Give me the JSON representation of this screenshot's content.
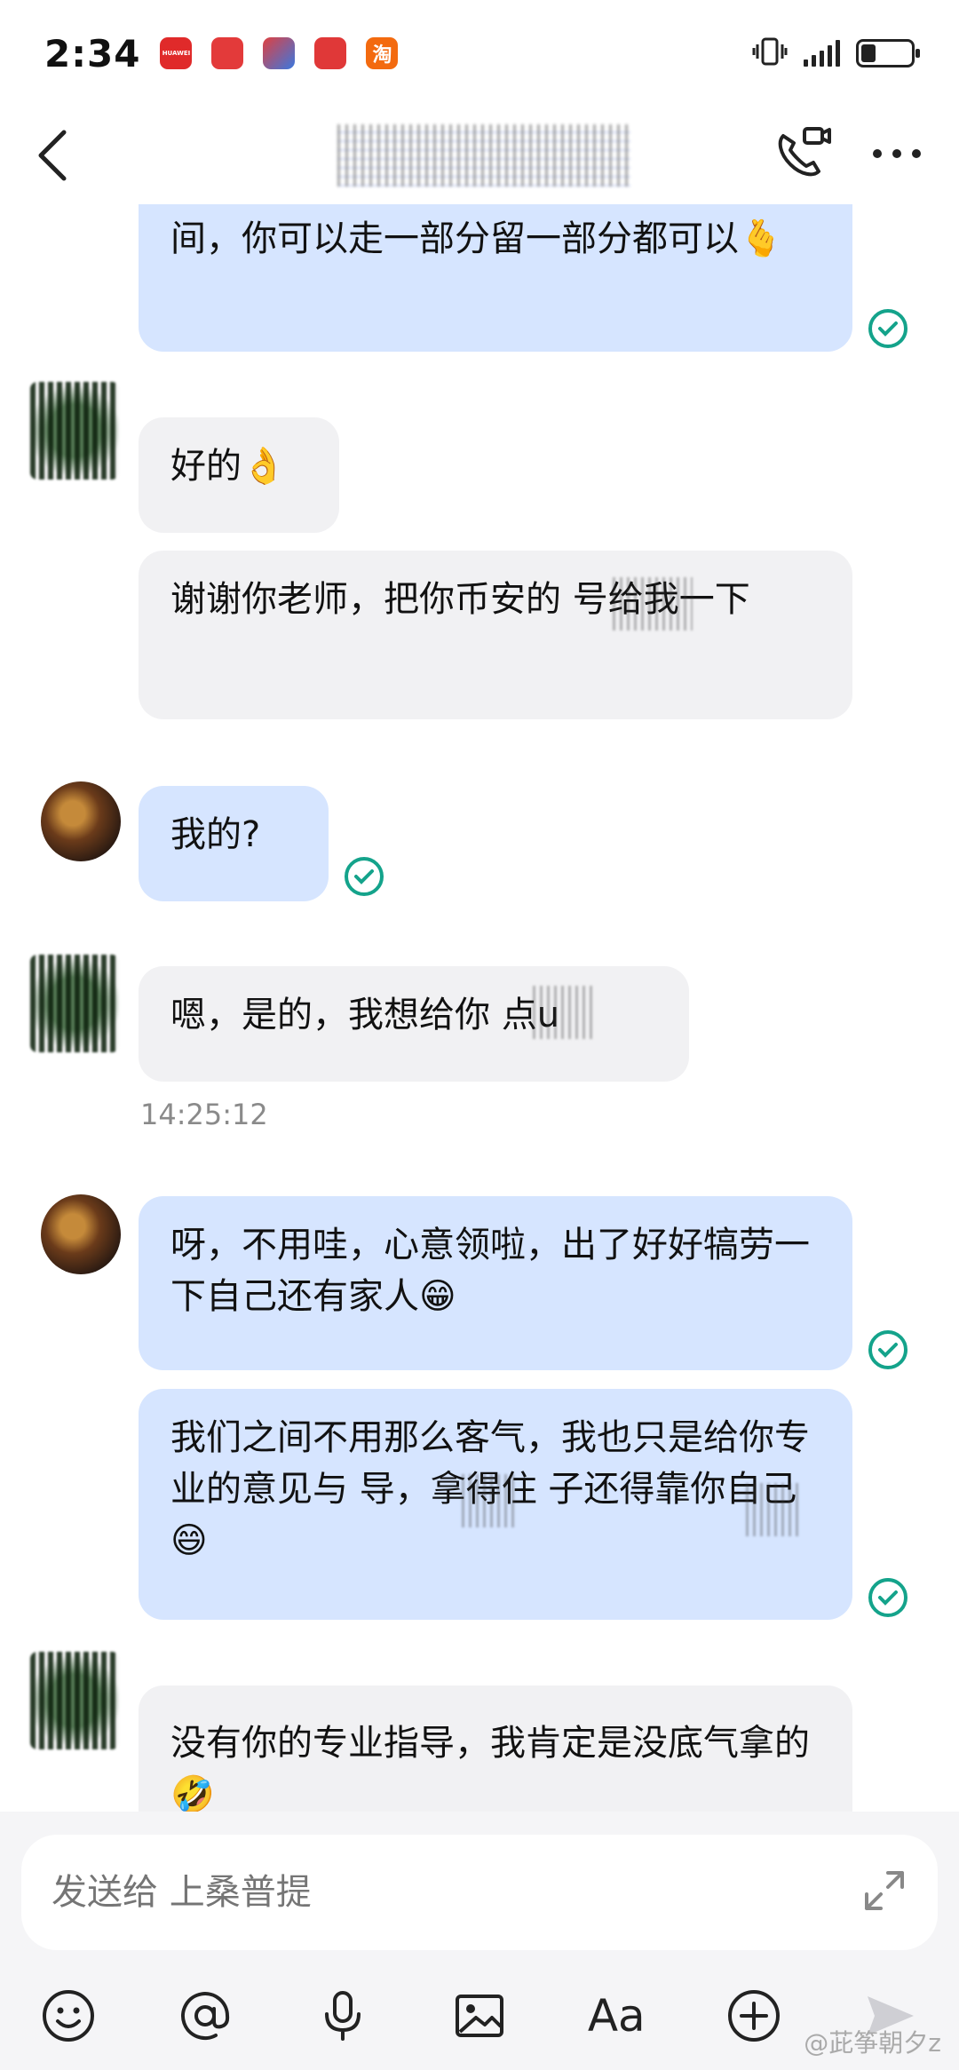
{
  "status_bar": {
    "time": "2:34",
    "apps": [
      {
        "name": "huawei-app-icon",
        "label": "HUAWEI",
        "color": "#e02a2a"
      },
      {
        "name": "red-app-icon",
        "label": "",
        "color": "#e33a3a"
      },
      {
        "name": "clown-app-icon",
        "label": "",
        "color": "#e04040"
      },
      {
        "name": "red-app-icon-2",
        "label": "",
        "color": "#e03838"
      },
      {
        "name": "taobao-app-icon",
        "label": "淘",
        "color": "#f36a0f"
      }
    ]
  },
  "header": {
    "title": ""
  },
  "messages": [
    {
      "side": "me",
      "text": "间，你可以走一部分留一部分都可以🫰",
      "read": true
    },
    {
      "side": "other",
      "text": "好的👌"
    },
    {
      "side": "other",
      "text": "谢谢你老师，把你币安的 号给我一下"
    },
    {
      "side": "me",
      "text": "我的?",
      "read": true
    },
    {
      "side": "other",
      "text": "嗯，是的，我想给你 点u"
    },
    {
      "side": "me",
      "text": "呀，不用哇，心意领啦，出了好好犒劳一下自己还有家人😁",
      "read": true
    },
    {
      "side": "me",
      "text": "我们之间不用那么客气，我也只是给你专业的意见与 导，拿得住 子还得靠你自己😄",
      "read": true
    },
    {
      "side": "other",
      "text": "没有你的专业指导，我肯定是没底气拿的🤣"
    }
  ],
  "timestamp": "14:25:12",
  "input": {
    "placeholder": "发送给 上桑普提"
  },
  "watermark": "@茈筝朝夕z",
  "colors": {
    "my_bubble": "#d6e5ff",
    "other_bubble": "#f1f1f3",
    "read_check": "#14a38b"
  }
}
